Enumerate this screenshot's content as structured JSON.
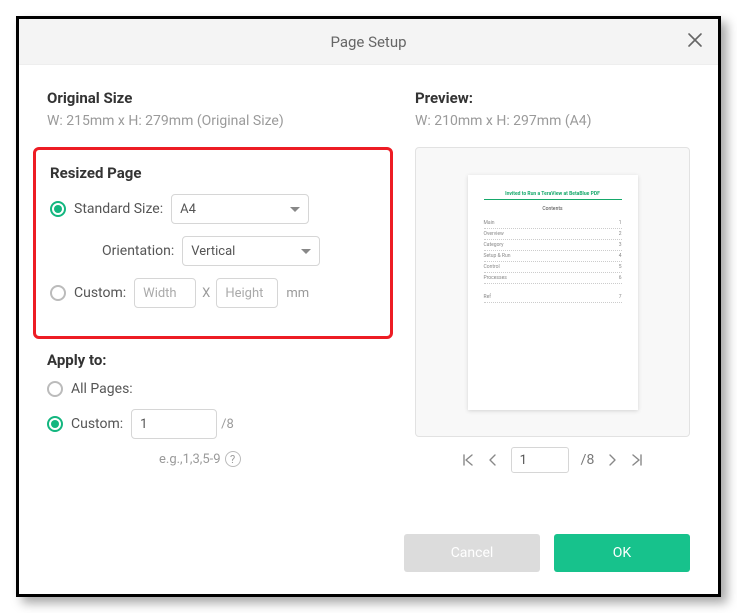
{
  "title": "Page Setup",
  "original": {
    "heading": "Original Size",
    "text": "W: 215mm x H: 279mm (Original Size)"
  },
  "resized": {
    "heading": "Resized Page",
    "standard_label": "Standard Size:",
    "standard_value": "A4",
    "orientation_label": "Orientation:",
    "orientation_value": "Vertical",
    "custom_label": "Custom:",
    "width_ph": "Width",
    "height_ph": "Height",
    "x": "X",
    "unit": "mm"
  },
  "apply": {
    "heading": "Apply to:",
    "all_label": "All Pages:",
    "custom_label": "Custom:",
    "custom_value": "1",
    "total_suffix": "/8",
    "hint": "e.g.,1,3,5-9"
  },
  "preview": {
    "heading": "Preview:",
    "text": "W: 210mm x H: 297mm (A4)",
    "page_hd": "Invited to Run a TeraView at BetaBlue PDF",
    "page_sub": "Contents",
    "pager_value": "1",
    "pager_total": "/8"
  },
  "buttons": {
    "cancel": "Cancel",
    "ok": "OK"
  }
}
